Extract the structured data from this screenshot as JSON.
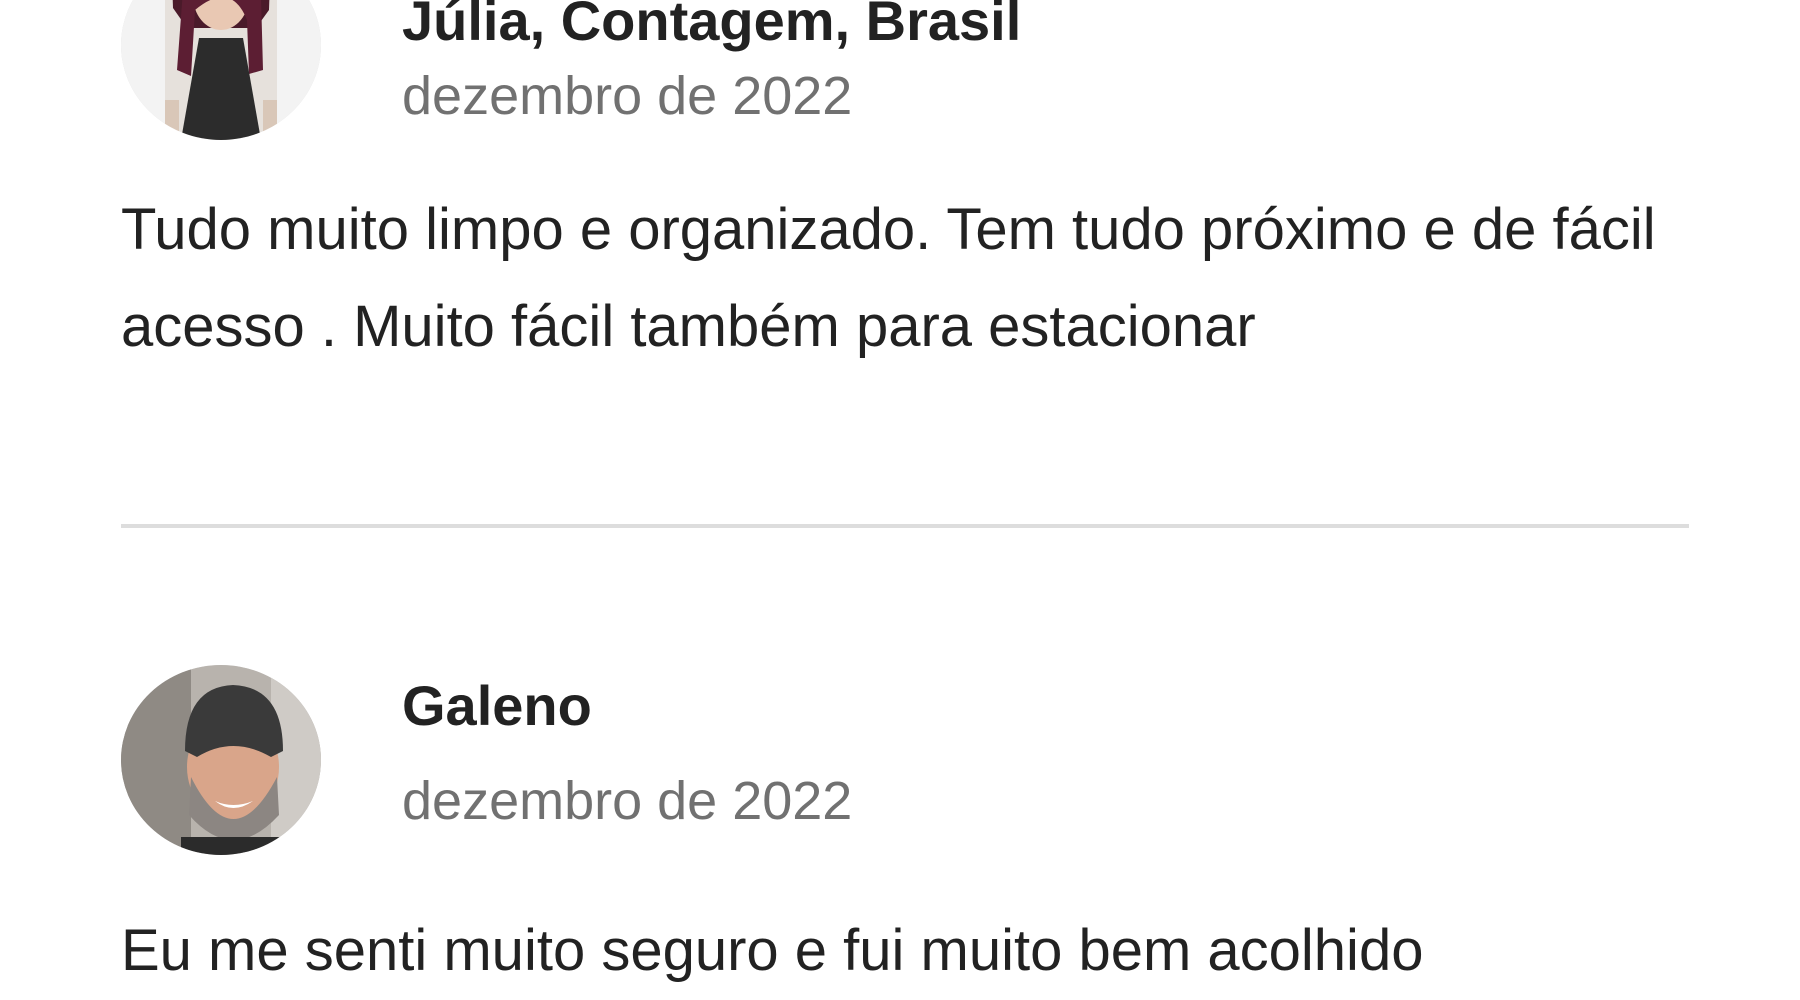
{
  "reviews": [
    {
      "name": "Júlia, Contagem, Brasil",
      "date": "dezembro de 2022",
      "text": "Tudo muito limpo e organizado. Tem tudo próximo e de fácil acesso . Muito fácil também para estacionar"
    },
    {
      "name": "Galeno",
      "date": "dezembro de 2022",
      "text": "Eu me senti muito seguro e fui muito bem acolhido"
    }
  ]
}
